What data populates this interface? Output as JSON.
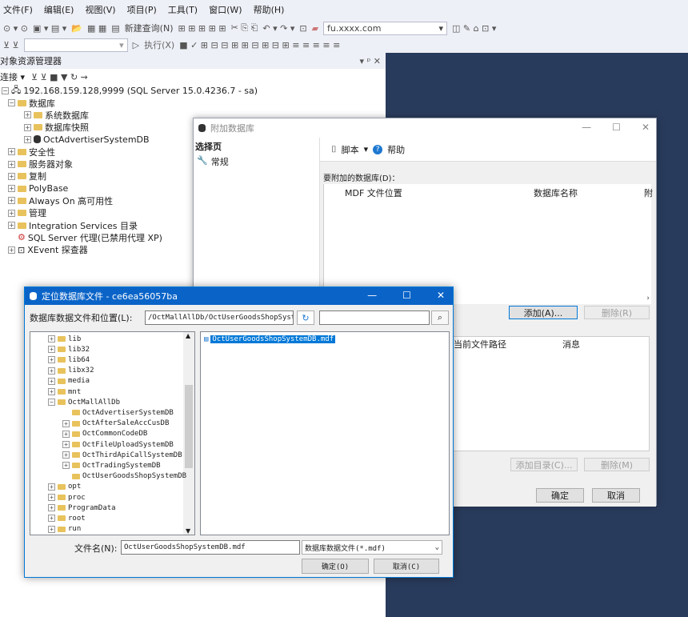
{
  "menu": [
    "文件(F)",
    "编辑(E)",
    "视图(V)",
    "项目(P)",
    "工具(T)",
    "窗口(W)",
    "帮助(H)"
  ],
  "toolbar": {
    "new_query": "新建查询(N)",
    "execute": "执行(X)",
    "server_combo": "fu.xxxx.com"
  },
  "object_explorer": {
    "title": "对象资源管理器",
    "title_controls": "▾ ᵖ ✕",
    "connect": "连接 ▾",
    "server": "192.168.159.128,9999 (SQL Server 15.0.4236.7 - sa)",
    "nodes": [
      {
        "label": "数据库",
        "level": 1,
        "expand": "−",
        "icon": "folder"
      },
      {
        "label": "系统数据库",
        "level": 2,
        "expand": "+",
        "icon": "folder"
      },
      {
        "label": "数据库快照",
        "level": 2,
        "expand": "+",
        "icon": "folder"
      },
      {
        "label": "OctAdvertiserSystemDB",
        "level": 2,
        "expand": "+",
        "icon": "db"
      },
      {
        "label": "安全性",
        "level": 1,
        "expand": "+",
        "icon": "folder"
      },
      {
        "label": "服务器对象",
        "level": 1,
        "expand": "+",
        "icon": "folder"
      },
      {
        "label": "复制",
        "level": 1,
        "expand": "+",
        "icon": "folder"
      },
      {
        "label": "PolyBase",
        "level": 1,
        "expand": "+",
        "icon": "folder"
      },
      {
        "label": "Always On 高可用性",
        "level": 1,
        "expand": "+",
        "icon": "folder"
      },
      {
        "label": "管理",
        "level": 1,
        "expand": "+",
        "icon": "folder"
      },
      {
        "label": "Integration Services 目录",
        "level": 1,
        "expand": "+",
        "icon": "folder"
      },
      {
        "label": "SQL Server 代理(已禁用代理 XP)",
        "level": 1,
        "expand": "",
        "icon": "agent"
      },
      {
        "label": "XEvent 探查器",
        "level": 1,
        "expand": "+",
        "icon": "xevent"
      }
    ]
  },
  "attach_dialog": {
    "title": "附加数据库",
    "select_page": "选择页",
    "page_general": "常规",
    "script": "脚本",
    "help": "帮助",
    "db_to_attach": "要附加的数据库(D)：",
    "col_mdf": "MDF 文件位置",
    "col_dbname": "数据库名称",
    "col_attach": "附",
    "add": "添加(A)...",
    "remove": "删除(R)",
    "col_current_path": "当前文件路径",
    "col_message": "消息",
    "add_catalog": "添加目录(C)...",
    "remove2": "删除(M)",
    "ok": "确定",
    "cancel": "取消"
  },
  "locate_dialog": {
    "title": "定位数据库文件 - ce6ea56057ba",
    "location_label": "数据库数据文件和位置(L):",
    "path": "/OctMallAllDb/OctUserGoodsShopSysten",
    "search_value": "",
    "folders": [
      {
        "label": "lib",
        "level": 0,
        "expand": "+"
      },
      {
        "label": "lib32",
        "level": 0,
        "expand": "+"
      },
      {
        "label": "lib64",
        "level": 0,
        "expand": "+"
      },
      {
        "label": "libx32",
        "level": 0,
        "expand": "+"
      },
      {
        "label": "media",
        "level": 0,
        "expand": "+"
      },
      {
        "label": "mnt",
        "level": 0,
        "expand": "+"
      },
      {
        "label": "OctMallAllDb",
        "level": 0,
        "expand": "−"
      },
      {
        "label": "OctAdvertiserSystemDB",
        "level": 1,
        "expand": ""
      },
      {
        "label": "OctAfterSaleAccCusDB",
        "level": 1,
        "expand": "+"
      },
      {
        "label": "OctCommonCodeDB",
        "level": 1,
        "expand": "+"
      },
      {
        "label": "OctFileUploadSystemDB",
        "level": 1,
        "expand": "+"
      },
      {
        "label": "OctThirdApiCallSystemDB",
        "level": 1,
        "expand": "+"
      },
      {
        "label": "OctTradingSystemDB",
        "level": 1,
        "expand": "+"
      },
      {
        "label": "OctUserGoodsShopSystemDB",
        "level": 1,
        "expand": ""
      },
      {
        "label": "opt",
        "level": 0,
        "expand": "+"
      },
      {
        "label": "proc",
        "level": 0,
        "expand": "+"
      },
      {
        "label": "ProgramData",
        "level": 0,
        "expand": "+"
      },
      {
        "label": "root",
        "level": 0,
        "expand": "+"
      },
      {
        "label": "run",
        "level": 0,
        "expand": "+"
      }
    ],
    "files": [
      "OctUserGoodsShopSystemDB.mdf"
    ],
    "filename_label": "文件名(N):",
    "filename": "OctUserGoodsShopSystemDB.mdf",
    "filetype": "数据库数据文件(*.mdf)",
    "ok": "确定(O)",
    "cancel": "取消(C)"
  }
}
